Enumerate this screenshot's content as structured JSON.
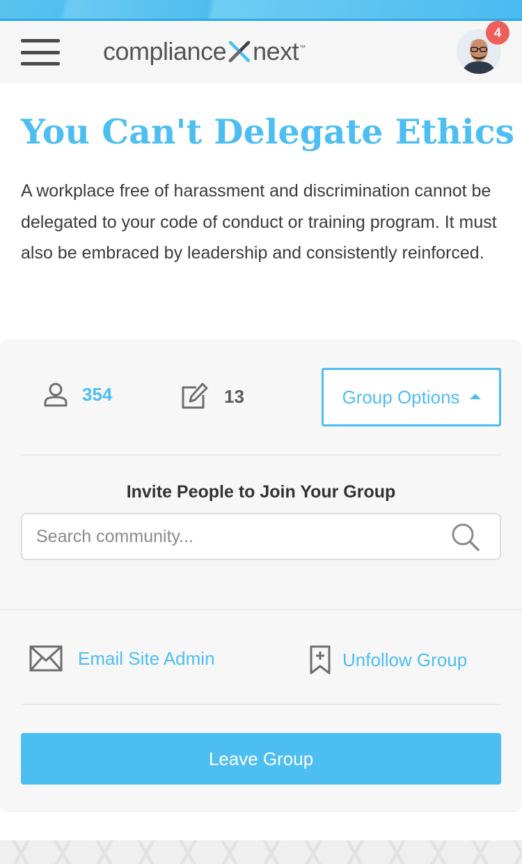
{
  "header": {
    "logo_left": "compliance",
    "logo_right": "next",
    "logo_tm": "™",
    "notification_count": "4"
  },
  "group": {
    "title": "You Can't Delegate Ethics",
    "description": "A workplace free of harassment and discrimination cannot be delegated to your code of conduct or training program. It must also be embraced by leadership and consistently reinforced."
  },
  "stats": {
    "members": "354",
    "posts": "13"
  },
  "options": {
    "label": "Group Options"
  },
  "invite": {
    "heading": "Invite People to Join Your Group",
    "placeholder": "Search community..."
  },
  "actions": {
    "email_label": "Email Site Admin",
    "unfollow_label": "Unfollow Group",
    "leave_label": "Leave Group"
  },
  "colors": {
    "accent": "#4dbef1",
    "badge": "#ef5f5a",
    "panel_bg": "#f7f7f7"
  },
  "icons": {
    "menu": "hamburger-menu-icon",
    "members": "user-icon",
    "posts": "edit-icon",
    "search": "search-icon",
    "email": "envelope-icon",
    "unfollow": "bookmark-plus-icon"
  }
}
